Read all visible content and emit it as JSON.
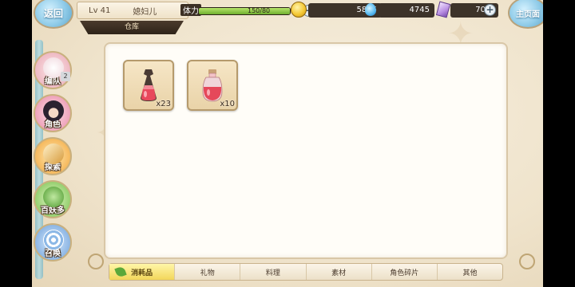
{
  "header": {
    "back_label": "返回",
    "home_label": "主页面",
    "level": "Lv 41",
    "player_name": "媳妇儿",
    "current_tab": "仓库"
  },
  "stamina": {
    "label": "体力",
    "current": 150,
    "max": 80,
    "text": "150/80",
    "fill_fraction": 1.0
  },
  "resources": {
    "gold": "5865",
    "gems": "4745",
    "tickets": "70"
  },
  "sidebar": {
    "items": [
      {
        "label": "编队",
        "badge": "2"
      },
      {
        "label": "角色"
      },
      {
        "label": "探索"
      },
      {
        "label": "百妖多"
      },
      {
        "label": "召唤"
      }
    ]
  },
  "inventory": {
    "items": [
      {
        "icon": "red-potion-flask-icon",
        "quantity": "x23"
      },
      {
        "icon": "red-potion-jar-icon",
        "quantity": "x10"
      }
    ]
  },
  "tabs": [
    {
      "label": "消耗品",
      "active": true
    },
    {
      "label": "礼物"
    },
    {
      "label": "料理"
    },
    {
      "label": "素材"
    },
    {
      "label": "角色碎片"
    },
    {
      "label": "其他"
    }
  ],
  "colors": {
    "panel_bg": "#fffdf8",
    "active_tab": "#f2d65a",
    "stamina_fill": "#6fae2e"
  }
}
